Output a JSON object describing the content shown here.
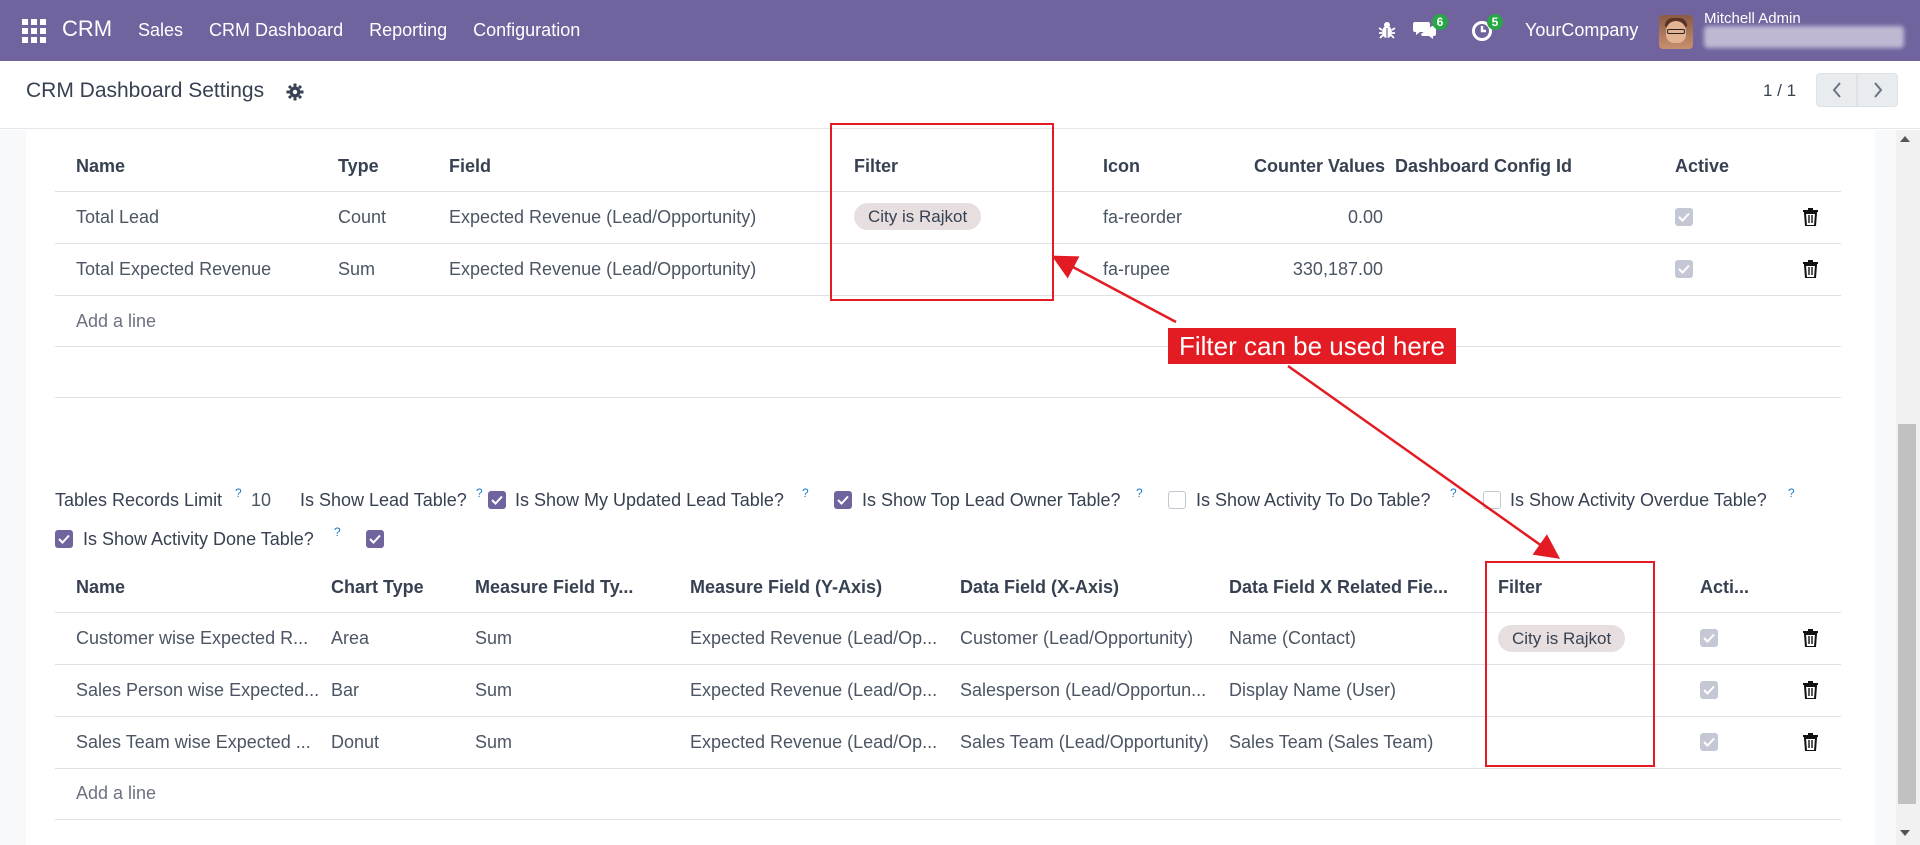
{
  "navbar": {
    "brand": "CRM",
    "menu": [
      "Sales",
      "CRM Dashboard",
      "Reporting",
      "Configuration"
    ],
    "chat_badge": "6",
    "activity_badge": "5",
    "company": "YourCompany",
    "user": "Mitchell Admin"
  },
  "control": {
    "title": "CRM Dashboard Settings",
    "pager": "1 / 1"
  },
  "counter_table": {
    "headers": [
      "Name",
      "Type",
      "Field",
      "Filter",
      "Icon",
      "Counter Values",
      "Dashboard Config Id",
      "Active"
    ],
    "rows": [
      {
        "name": "Total Lead",
        "type": "Count",
        "field": "Expected Revenue (Lead/Opportunity)",
        "filter": "City is Rajkot",
        "icon": "fa-reorder",
        "value": "0.00",
        "config": "",
        "active": true
      },
      {
        "name": "Total Expected Revenue",
        "type": "Sum",
        "field": "Expected Revenue (Lead/Opportunity)",
        "filter": "",
        "icon": "fa-rupee",
        "value": "330,187.00",
        "config": "",
        "active": true
      }
    ],
    "add_line": "Add a line"
  },
  "settings": {
    "tables_records_limit_label": "Tables Records Limit",
    "tables_records_limit_value": "10",
    "help_mark": "?",
    "show_lead_table_label": "Is Show Lead Table?",
    "show_lead_table": true,
    "show_my_updated_label": "Is Show My Updated Lead Table?",
    "show_my_updated": true,
    "show_top_owner_label": "Is Show Top Lead Owner Table?",
    "show_top_owner": false,
    "show_todo_label": "Is Show Activity To Do Table?",
    "show_todo": false,
    "show_overdue_label": "Is Show Activity Overdue Table?",
    "show_overdue": true,
    "show_done_label": "Is Show Activity Done Table?",
    "show_done": true
  },
  "chart_table": {
    "headers": [
      "Name",
      "Chart Type",
      "Measure Field Ty...",
      "Measure Field (Y-Axis)",
      "Data Field (X-Axis)",
      "Data Field X Related Fie...",
      "Filter",
      "Acti..."
    ],
    "rows": [
      {
        "name": "Customer wise Expected R...",
        "chart": "Area",
        "measure_type": "Sum",
        "measure": "Expected Revenue (Lead/Op...",
        "x": "Customer (Lead/Opportunity)",
        "x_rel": "Name (Contact)",
        "filter": "City is Rajkot",
        "active": true
      },
      {
        "name": "Sales Person wise Expected...",
        "chart": "Bar",
        "measure_type": "Sum",
        "measure": "Expected Revenue (Lead/Op...",
        "x": "Salesperson (Lead/Opportun...",
        "x_rel": "Display Name (User)",
        "filter": "",
        "active": true
      },
      {
        "name": "Sales Team wise Expected ...",
        "chart": "Donut",
        "measure_type": "Sum",
        "measure": "Expected Revenue (Lead/Op...",
        "x": "Sales Team (Lead/Opportunity)",
        "x_rel": "Sales Team (Sales Team)",
        "filter": "",
        "active": true
      }
    ],
    "add_line": "Add a line"
  },
  "annotation": {
    "callout": "Filter can be used here",
    "color": "#e31b23"
  },
  "colors": {
    "navbar": "#71639e",
    "checkbox_checked": "#71639e",
    "badge": "#28a745"
  }
}
